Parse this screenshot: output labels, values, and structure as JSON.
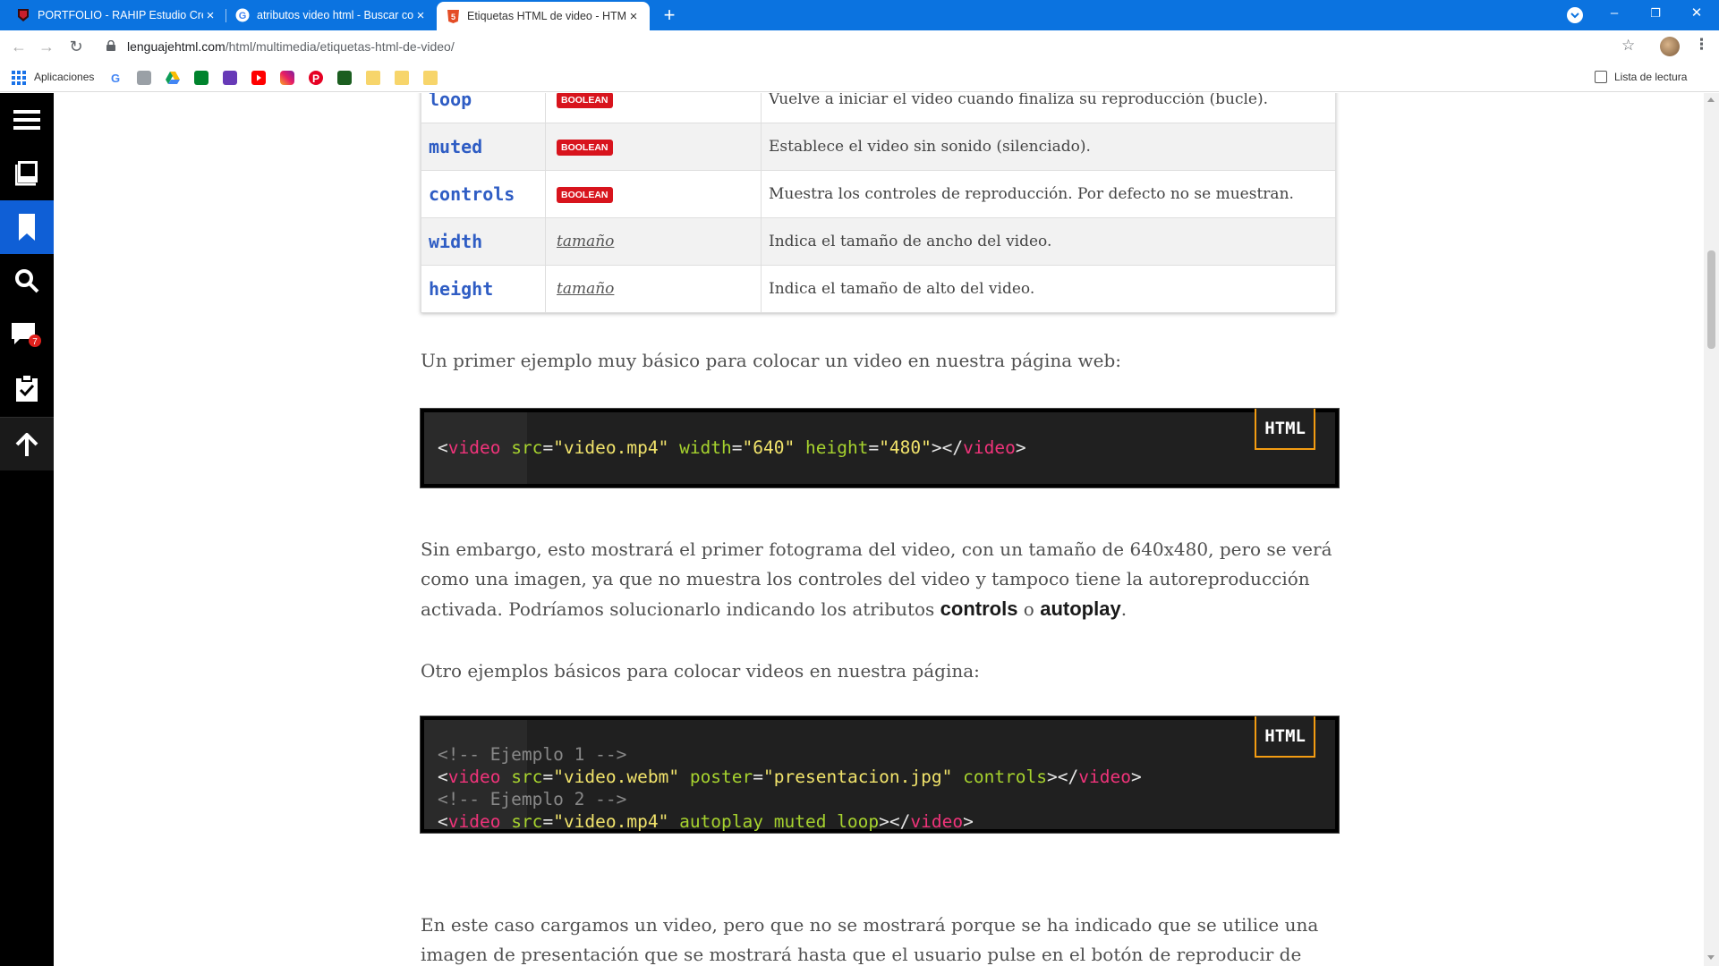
{
  "browser": {
    "tabs": [
      {
        "title": "PORTFOLIO - RAHIP Estudio Creativo",
        "close": "×",
        "active": false
      },
      {
        "title": "atributos video html - Buscar con Google",
        "close": "×",
        "active": false
      },
      {
        "title": "Etiquetas HTML de video - HTML en español",
        "close": "×",
        "active": true
      }
    ],
    "new_tab": "+",
    "window_controls": {
      "minimize": "–",
      "restore": "❐",
      "close": "✕"
    },
    "url_host": "lenguajehtml.com",
    "url_path": "/html/multimedia/etiquetas-html-de-video/",
    "bookmarks_apps_label": "Aplicaciones",
    "reading_list_label": "Lista de lectura",
    "colors": {
      "tabstrip": "#0b73e0",
      "accent": "#0f5fd6"
    }
  },
  "site_sidebar": {
    "items": [
      "menu-icon",
      "book-icon",
      "bookmark-icon",
      "search-icon",
      "comments-icon",
      "clipboard-check-icon",
      "arrow-up-icon"
    ],
    "comments_badge": "7"
  },
  "attributes_table": {
    "rows": [
      {
        "name": "loop",
        "type": "BOOLEAN",
        "type_kind": "badge",
        "desc": "Vuelve a iniciar el video cuando finaliza su reproducción (bucle)."
      },
      {
        "name": "muted",
        "type": "BOOLEAN",
        "type_kind": "badge",
        "desc": "Establece el video sin sonido (silenciado)."
      },
      {
        "name": "controls",
        "type": "BOOLEAN",
        "type_kind": "badge",
        "desc": "Muestra los controles de reproducción. Por defecto no se muestran."
      },
      {
        "name": "width",
        "type": "tamaño",
        "type_kind": "link",
        "desc": "Indica el tamaño de ancho del video."
      },
      {
        "name": "height",
        "type": "tamaño",
        "type_kind": "link",
        "desc": "Indica el tamaño de alto del video."
      }
    ]
  },
  "article": {
    "p1": "Un primer ejemplo muy básico para colocar un video en nuestra página web:",
    "code1_lang": "HTML",
    "p2_before": "Sin embargo, esto mostrará el primer fotograma del video, con un tamaño de 640x480, pero se verá como una imagen, ya que no muestra los controles del video y tampoco tiene la autoreproducción activada. Podríamos solucionarlo indicando los atributos ",
    "p2_bold1": "controls",
    "p2_mid": " o ",
    "p2_bold2": "autoplay",
    "p2_after": ".",
    "p3": "Otro ejemplos básicos para colocar videos en nuestra página:",
    "code2_lang": "HTML",
    "p4": "En este caso cargamos un video, pero que no se mostrará porque se ha indicado que se utilice una imagen de presentación que se mostrará hasta que el usuario pulse en el botón de reproducir de"
  },
  "code1": {
    "tag": "video",
    "src_attr": "src",
    "src_val": "\"video.mp4\"",
    "w_attr": "width",
    "w_val": "\"640\"",
    "h_attr": "height",
    "h_val": "\"480\""
  },
  "code2": {
    "comment1": "<!-- Ejemplo 1 -->",
    "comment2": "<!-- Ejemplo 2 -->",
    "tag": "video",
    "l1_src_attr": "src",
    "l1_src_val": "\"video.webm\"",
    "l1_poster_attr": "poster",
    "l1_poster_val": "\"presentacion.jpg\"",
    "l1_flag": "controls",
    "l2_src_attr": "src",
    "l2_src_val": "\"video.mp4\"",
    "l2_flags": "autoplay muted loop"
  }
}
